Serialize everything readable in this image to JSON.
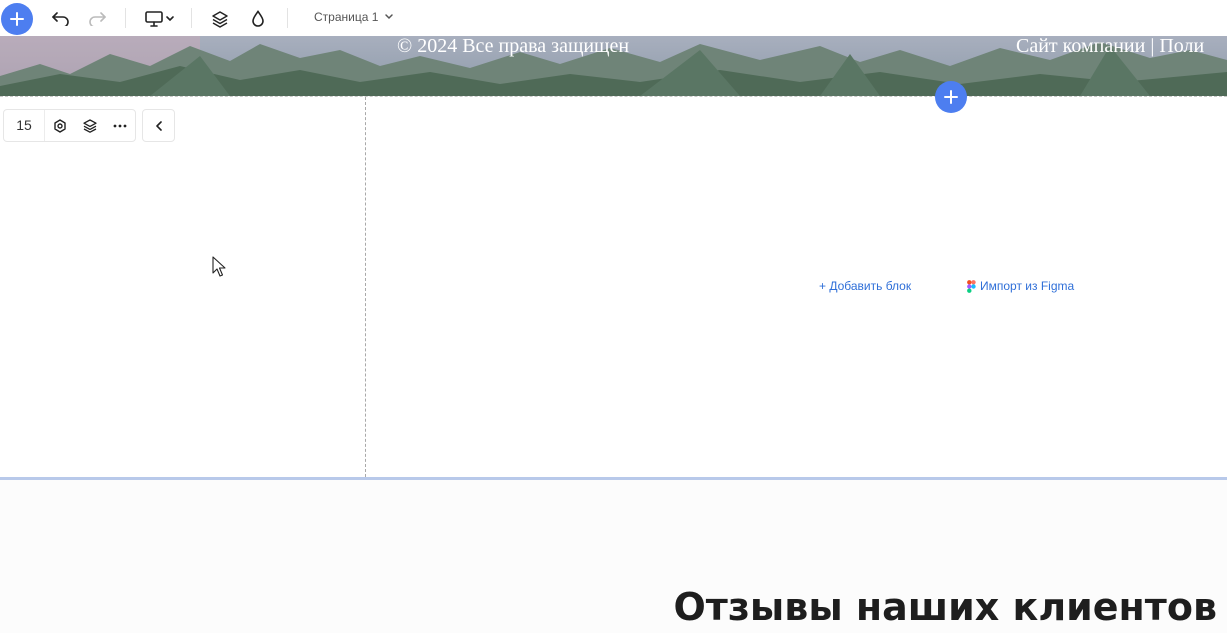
{
  "toolbar": {
    "page_label": "Страница 1",
    "icons": [
      "plus-icon",
      "undo-icon",
      "redo-icon",
      "desktop-icon",
      "chevron-down-icon",
      "layers-icon",
      "drop-icon"
    ]
  },
  "footer_banner": {
    "copyright": "© 2024 Все права защищен",
    "site": "Сайт компании | Поли"
  },
  "block_toolbar": {
    "number": "15",
    "icons": [
      "settings-icon",
      "layers-icon",
      "more-icon",
      "chevron-left-icon"
    ]
  },
  "empty_block": {
    "add_block_label": "+ Добавить блок",
    "import_figma_label": "Импорт из Figma"
  },
  "next_section": {
    "title": "Отзывы наших клиентов"
  },
  "colors": {
    "accent": "#4d7ef0",
    "link": "#2f6fd8"
  }
}
